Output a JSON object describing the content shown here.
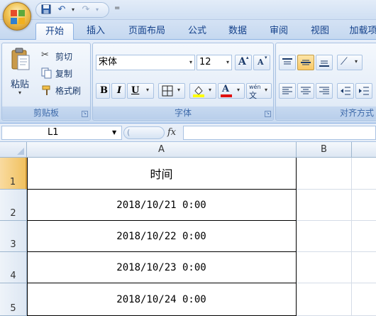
{
  "quick_access": {
    "icons": [
      "save-icon",
      "undo-icon",
      "redo-icon",
      "customize-qat-icon"
    ],
    "more": "="
  },
  "tabs": [
    "开始",
    "插入",
    "页面布局",
    "公式",
    "数据",
    "审阅",
    "视图",
    "加载项"
  ],
  "ribbon": {
    "clipboard": {
      "label": "剪贴板",
      "paste": "粘贴",
      "cut": "剪切",
      "copy": "复制",
      "format_painter": "格式刷"
    },
    "font": {
      "label": "字体",
      "font_name": "宋体",
      "font_size": "12",
      "grow": "A",
      "shrink": "A",
      "bold": "B",
      "italic": "I",
      "underline": "U",
      "font_color": "A",
      "phonetic": "wén"
    },
    "alignment": {
      "label": "对齐方式"
    }
  },
  "formula_bar": {
    "name_box": "L1",
    "fx": "fx",
    "value": ""
  },
  "sheet": {
    "columns": [
      "A",
      "B"
    ],
    "rows": [
      {
        "num": "1",
        "a": "时间"
      },
      {
        "num": "2",
        "a": "2018/10/21 0:00"
      },
      {
        "num": "3",
        "a": "2018/10/22 0:00"
      },
      {
        "num": "4",
        "a": "2018/10/23 0:00"
      },
      {
        "num": "5",
        "a": "2018/10/24 0:00"
      }
    ]
  },
  "colors": {
    "accent": "#15428b",
    "selection_header": "#f1c15f",
    "ribbon_bg": "#dbe6f5"
  }
}
